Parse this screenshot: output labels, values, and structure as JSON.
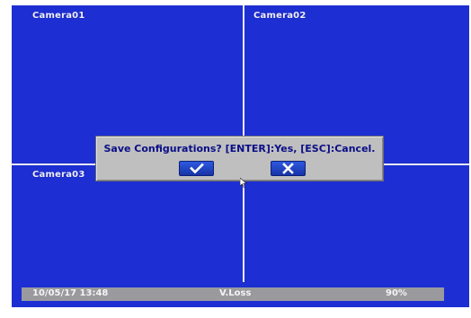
{
  "cameras": [
    {
      "label": "Camera01"
    },
    {
      "label": "Camera02"
    },
    {
      "label": "Camera03"
    }
  ],
  "dialog": {
    "message": "Save Configurations? [ENTER]:Yes, [ESC]:Cancel.",
    "confirm_icon": "checkmark-icon",
    "cancel_icon": "x-icon"
  },
  "status_bar": {
    "datetime": "10/05/17 13:48",
    "signal_status": "V.Loss",
    "storage_level": "90%"
  },
  "colors": {
    "video_background": "#1d2fd2",
    "dialog_background": "#bfbfbf",
    "dialog_text": "#0a0e86",
    "button": "#2a4fd6",
    "status_bar": "#9a9a9e"
  }
}
